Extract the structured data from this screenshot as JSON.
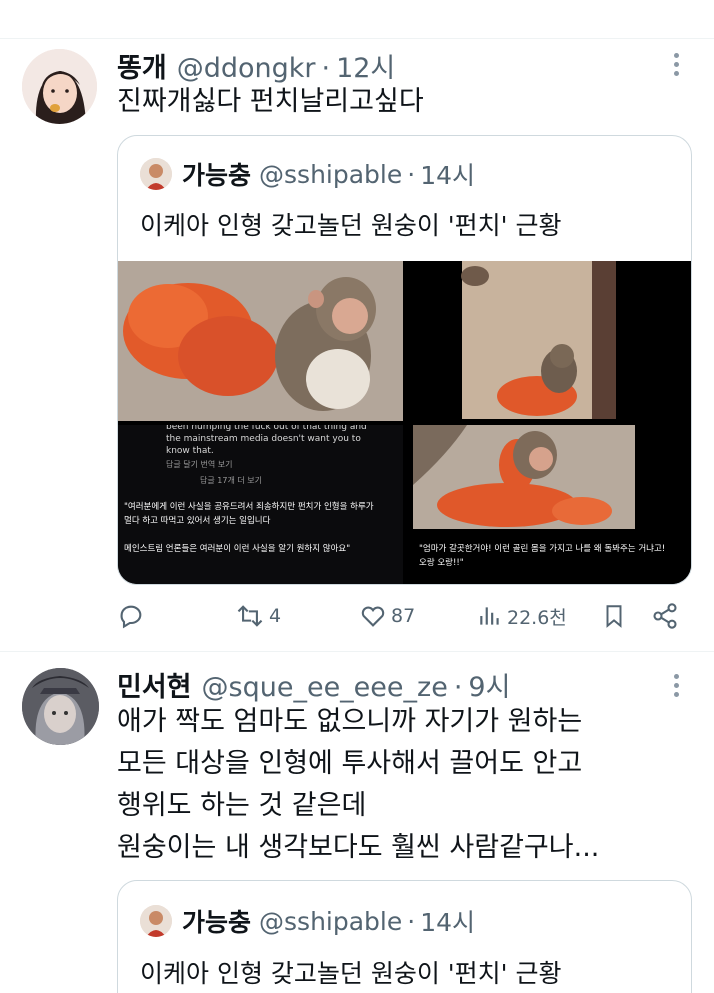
{
  "tweets": [
    {
      "name": "똥개",
      "handle": "@ddongkr",
      "dot": "·",
      "time": "12시",
      "text": "진짜개싫다 펀치날리고싶다",
      "quote": {
        "name": "가능충",
        "handle": "@sshipable",
        "dot": "·",
        "time": "14시",
        "text": "이케아 인형 갖고놀던 원숭이 '펀치' 근황",
        "captions": {
          "en_1": "been humping the fuck out of that thing and",
          "en_2": "the mainstream media doesn't want you to",
          "en_3": "know that.",
          "meta_1": "답글 달기     번역 보기",
          "meta_2": "답글 17개 더 보기",
          "ko_1": "\"여러분에게 이런 사실을 공유드려서 죄송하지만 펀치가 인형을 하루가",
          "ko_2": "멀다 하고 따먹고 있어서 생기는 일입니다",
          "ko_3": "메인스트림 언론들은 여러분이 이런 사실을 알기 원하지 않아요\"",
          "ko_4": "\"엄마가 갈곳한거야! 이런 골린 몸을 가지고 나를 왜 돌봐주는 거냐고!",
          "ko_5": "오랑 오랑!!\""
        }
      },
      "actions": {
        "reply_icon": "reply-icon",
        "retweet_icon": "retweet-icon",
        "retweet_count": "4",
        "like_icon": "heart-icon",
        "like_count": "87",
        "views_icon": "views-icon",
        "views_count": "22.6천",
        "bookmark_icon": "bookmark-icon",
        "share_icon": "share-icon"
      }
    },
    {
      "name": "민서현",
      "handle": "@sque_ee_eee_ze",
      "dot": "·",
      "time": "9시",
      "lines": [
        "애가 짝도 엄마도 없으니까 자기가 원하는",
        "모든 대상을 인형에 투사해서 끌어도 안고",
        "행위도 하는 것 같은데",
        "원숭이는 내 생각보다도 훨씬 사람같구나..."
      ],
      "quote": {
        "name": "가능충",
        "handle": "@sshipable",
        "dot": "·",
        "time": "14시",
        "text": "이케아 인형 갖고놀던 원숭이 '펀치' 근황"
      }
    }
  ],
  "colors": {
    "text": "#0f1419",
    "secondary": "#536471",
    "border": "#cfd9de",
    "plush": "#e0582a",
    "monkey": "#8a7a6a"
  }
}
